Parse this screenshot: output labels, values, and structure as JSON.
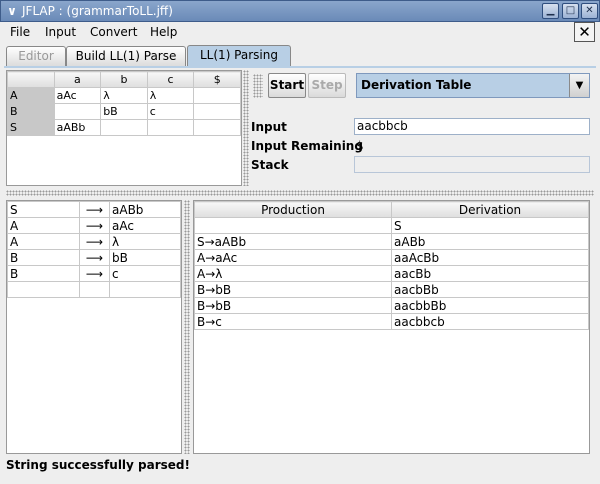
{
  "window": {
    "title": "JFLAP : (grammarToLL.jff)"
  },
  "menu": [
    "File",
    "Input",
    "Convert",
    "Help"
  ],
  "tabs": [
    "Editor",
    "Build LL(1) Parse",
    "LL(1) Parsing"
  ],
  "parse_table": {
    "headers": [
      "",
      "a",
      "b",
      "c",
      "$"
    ],
    "rows": [
      [
        "A",
        "aAc",
        "λ",
        "λ",
        ""
      ],
      [
        "B",
        "",
        "bB",
        "c",
        ""
      ],
      [
        "S",
        "aABb",
        "",
        "",
        ""
      ]
    ]
  },
  "controls": {
    "start_label": "Start",
    "step_label": "Step",
    "mode_value": "Derivation Table",
    "input_label": "Input",
    "input_value": "aacbbcb",
    "remaining_label": "Input Remaining",
    "remaining_value": "$",
    "stack_label": "Stack",
    "stack_value": ""
  },
  "grammar": {
    "arrow": "⟶",
    "rows": [
      [
        "S",
        "aABb"
      ],
      [
        "A",
        "aAc"
      ],
      [
        "A",
        "λ"
      ],
      [
        "B",
        "bB"
      ],
      [
        "B",
        "c"
      ],
      [
        "",
        ""
      ]
    ]
  },
  "derivation": {
    "headers": [
      "Production",
      "Derivation"
    ],
    "rows": [
      [
        "",
        "S"
      ],
      [
        "S→aABb",
        "aABb"
      ],
      [
        "A→aAc",
        "aaAcBb"
      ],
      [
        "A→λ",
        "aacBb"
      ],
      [
        "B→bB",
        "aacbBb"
      ],
      [
        "B→bB",
        "aacbbBb"
      ],
      [
        "B→c",
        "aacbbcb"
      ]
    ]
  },
  "status": "String successfully parsed!"
}
